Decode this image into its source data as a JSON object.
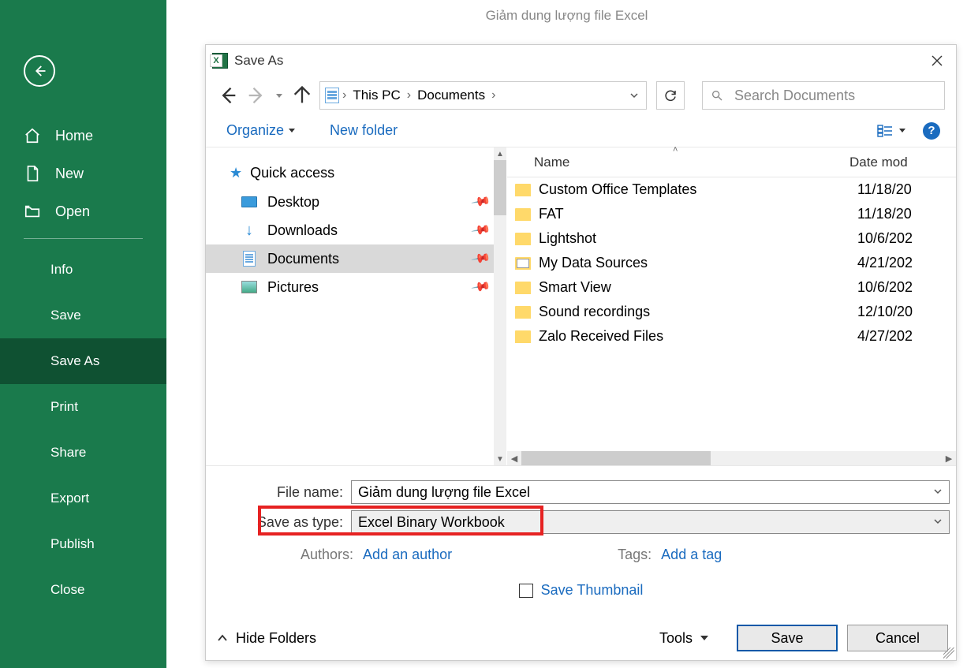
{
  "title_bar": "Giảm dung lượng file Excel",
  "sidebar": {
    "home": "Home",
    "new": "New",
    "open": "Open",
    "info": "Info",
    "save": "Save",
    "save_as": "Save As",
    "print": "Print",
    "share": "Share",
    "export": "Export",
    "publish": "Publish",
    "close": "Close"
  },
  "dialog": {
    "title": "Save As",
    "breadcrumb": {
      "root": "This PC",
      "folder": "Documents"
    },
    "search_placeholder": "Search Documents",
    "toolbar": {
      "organize": "Organize",
      "new_folder": "New folder"
    },
    "tree": {
      "quick_access": "Quick access",
      "desktop": "Desktop",
      "downloads": "Downloads",
      "documents": "Documents",
      "pictures": "Pictures"
    },
    "list": {
      "col_name": "Name",
      "col_date": "Date mod",
      "rows": [
        {
          "name": "Custom Office Templates",
          "date": "11/18/20"
        },
        {
          "name": "FAT",
          "date": "11/18/20"
        },
        {
          "name": "Lightshot",
          "date": "10/6/202"
        },
        {
          "name": "My Data Sources",
          "date": "4/21/202"
        },
        {
          "name": "Smart View",
          "date": "10/6/202"
        },
        {
          "name": "Sound recordings",
          "date": "12/10/20"
        },
        {
          "name": "Zalo Received Files",
          "date": "4/27/202"
        }
      ]
    },
    "form": {
      "file_name_label": "File name:",
      "file_name_value": "Giảm dung lượng file Excel",
      "save_type_label": "Save as type:",
      "save_type_value": "Excel Binary Workbook",
      "authors_label": "Authors:",
      "authors_link": "Add an author",
      "tags_label": "Tags:",
      "tags_link": "Add a tag",
      "thumbnail": "Save Thumbnail"
    },
    "footer": {
      "hide_folders": "Hide Folders",
      "tools": "Tools",
      "save": "Save",
      "cancel": "Cancel"
    }
  }
}
